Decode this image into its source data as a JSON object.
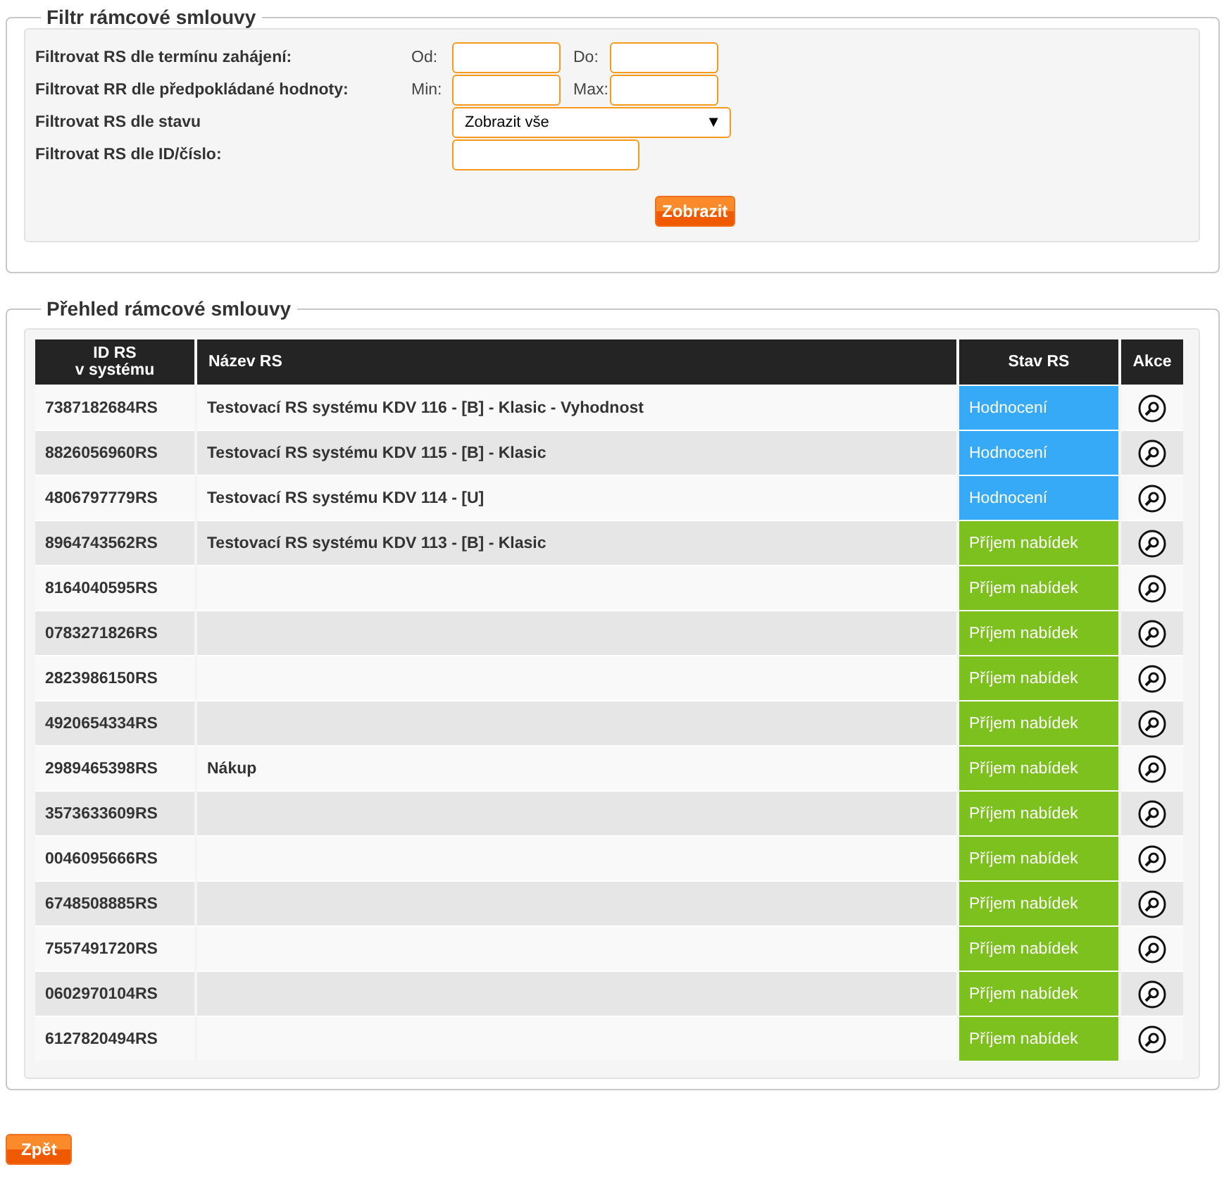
{
  "filter": {
    "legend": "Filtr rámcové smlouvy",
    "rows": [
      {
        "kind": "range",
        "label": "Filtrovat RS dle termínu zahájení:",
        "from_label": "Od:",
        "to_label": "Do:"
      },
      {
        "kind": "range",
        "label": "Filtrovat RR dle předpokládané hodnoty:",
        "from_label": "Min:",
        "to_label": "Max:"
      },
      {
        "kind": "select",
        "label": "Filtrovat RS dle stavu",
        "value": "Zobrazit vše",
        "arrow": "▼"
      },
      {
        "kind": "text",
        "label": "Filtrovat RS dle ID/číslo:"
      }
    ],
    "button": "Zobrazit"
  },
  "overview": {
    "legend": "Přehled rámcové smlouvy",
    "columns": [
      {
        "line1": "ID RS",
        "line2": "v systému"
      },
      {
        "line1": "Název RS"
      },
      {
        "line1": "Stav RS"
      },
      {
        "line1": "Akce"
      }
    ],
    "rows": [
      {
        "id": "7387182684RS",
        "name": "Testovací RS systému KDV 116 - [B] - Klasic - Vyhodnost",
        "status": "Hodnocení",
        "color": "#36a9f7"
      },
      {
        "id": "8826056960RS",
        "name": "Testovací RS systému KDV 115 - [B] - Klasic",
        "status": "Hodnocení",
        "color": "#36a9f7"
      },
      {
        "id": "4806797779RS",
        "name": "Testovací RS systému KDV 114 - [U]",
        "status": "Hodnocení",
        "color": "#36a9f7"
      },
      {
        "id": "8964743562RS",
        "name": "Testovací RS systému KDV 113 - [B] - Klasic",
        "status": "Příjem nabídek",
        "color": "#7dc11e"
      },
      {
        "id": "8164040595RS",
        "status": "Příjem nabídek",
        "color": "#7dc11e"
      },
      {
        "id": "0783271826RS",
        "status": "Příjem nabídek",
        "color": "#7dc11e"
      },
      {
        "id": "2823986150RS",
        "status": "Příjem nabídek",
        "color": "#7dc11e"
      },
      {
        "id": "4920654334RS",
        "status": "Příjem nabídek",
        "color": "#7dc11e"
      },
      {
        "id": "2989465398RS",
        "name": "Nákup",
        "status": "Příjem nabídek",
        "color": "#7dc11e"
      },
      {
        "id": "3573633609RS",
        "status": "Příjem nabídek",
        "color": "#7dc11e"
      },
      {
        "id": "0046095666RS",
        "status": "Příjem nabídek",
        "color": "#7dc11e"
      },
      {
        "id": "6748508885RS",
        "status": "Příjem nabídek",
        "color": "#7dc11e"
      },
      {
        "id": "7557491720RS",
        "status": "Příjem nabídek",
        "color": "#7dc11e"
      },
      {
        "id": "0602970104RS",
        "status": "Příjem nabídek",
        "color": "#7dc11e"
      },
      {
        "id": "6127820494RS",
        "status": "Příjem nabídek",
        "color": "#7dc11e"
      }
    ]
  },
  "back_button": "Zpět"
}
